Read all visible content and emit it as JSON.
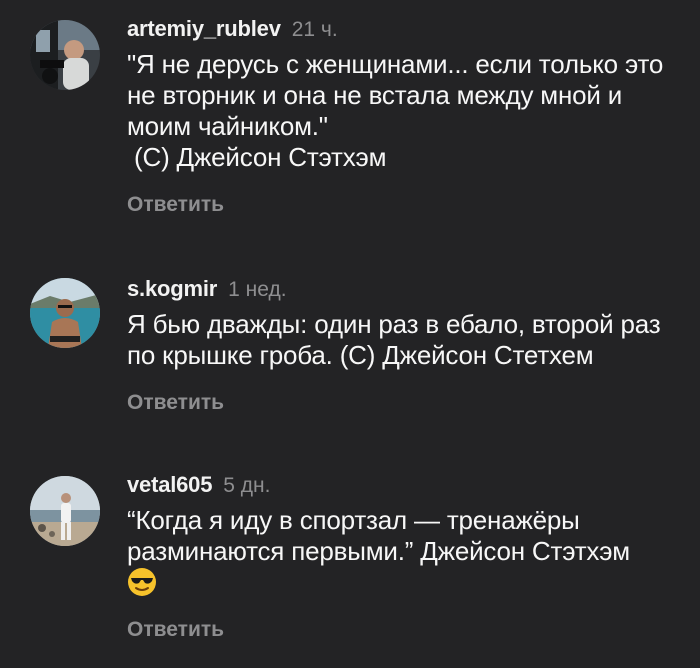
{
  "comments": [
    {
      "username": "artemiy_rublev",
      "time": "21 ч.",
      "text": "\"Я не дерусь с женщинами... если только это не вторник и она не встала между мной и моим чайником.\"\n (С) Джейсон Стэтхэм",
      "reply_label": "Ответить",
      "avatar_icon": "avatar-photo-man-in-car"
    },
    {
      "username": "s.kogmir",
      "time": "1 нед.",
      "text": "Я бью дважды: один раз в ебало, второй раз по крышке гроба. (С) Джейсон Стетхем",
      "reply_label": "Ответить",
      "avatar_icon": "avatar-photo-man-in-sea"
    },
    {
      "username": "vetal605",
      "time": "5 дн.",
      "text": "“Когда я иду в спортзал — тренажёры разминаются первыми.” Джейсон Стэтхэм",
      "emoji": "sunglasses-emoji",
      "reply_label": "Ответить",
      "avatar_icon": "avatar-photo-man-on-beach"
    }
  ],
  "colors": {
    "background": "#232325",
    "primary_text": "#f7f7f7",
    "secondary_text": "#8e8e90"
  }
}
